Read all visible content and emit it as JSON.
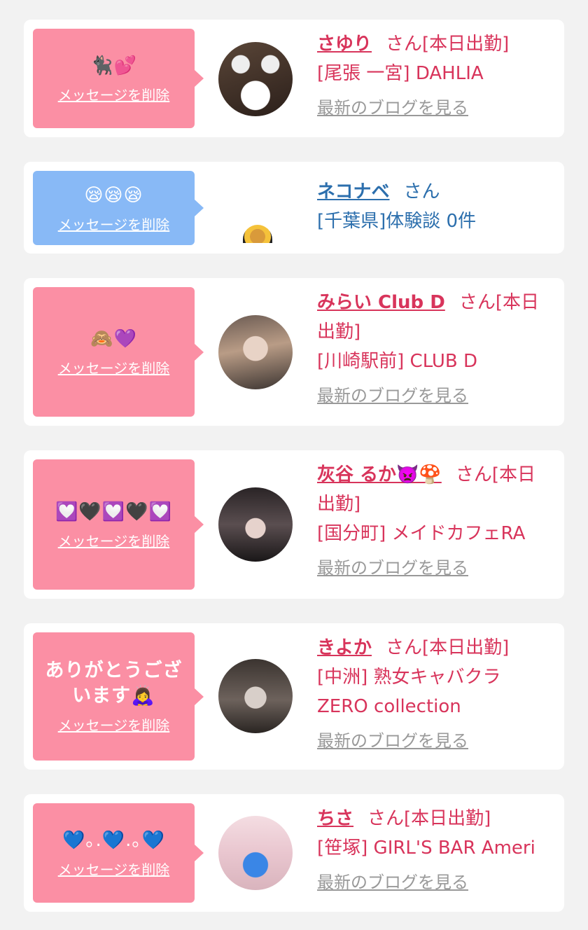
{
  "delete_label": "メッセージを削除",
  "blog_label": "最新のブログを見る",
  "honorific": "さん",
  "colors": {
    "pink_bubble": "#fb8fa4",
    "blue_bubble": "#88b9f6",
    "pink_text": "#d8345b",
    "blue_text": "#2c6fad"
  },
  "items": [
    {
      "message": "🐈‍⬛💕",
      "name": "さゆり",
      "status": "[本日出勤]",
      "shop": "[尾張 一宮] DAHLIA"
    },
    {
      "message": "😪😪😪",
      "name": "ネコナベ",
      "status": "",
      "shop": "[千葉県]体験談 0件"
    },
    {
      "message": "🙈💜",
      "name": "みらい Club D",
      "status": "[本日出勤]",
      "shop": "[川崎駅前] CLUB D"
    },
    {
      "message": "💟🖤💟🖤💟",
      "name": "灰谷 るか👿🍄",
      "status": "[本日出勤]",
      "shop": "[国分町] メイドカフェRA"
    },
    {
      "message": "ありがとうございます🙇‍♀️",
      "name": "きよか",
      "status": "[本日出勤]",
      "shop": "[中洲] 熟女キャバクラZERO collection"
    },
    {
      "message": "💙｡.💙.｡💙",
      "name": "ちさ",
      "status": "[本日出勤]",
      "shop": "[笹塚] GIRL'S BAR Ameri"
    }
  ]
}
